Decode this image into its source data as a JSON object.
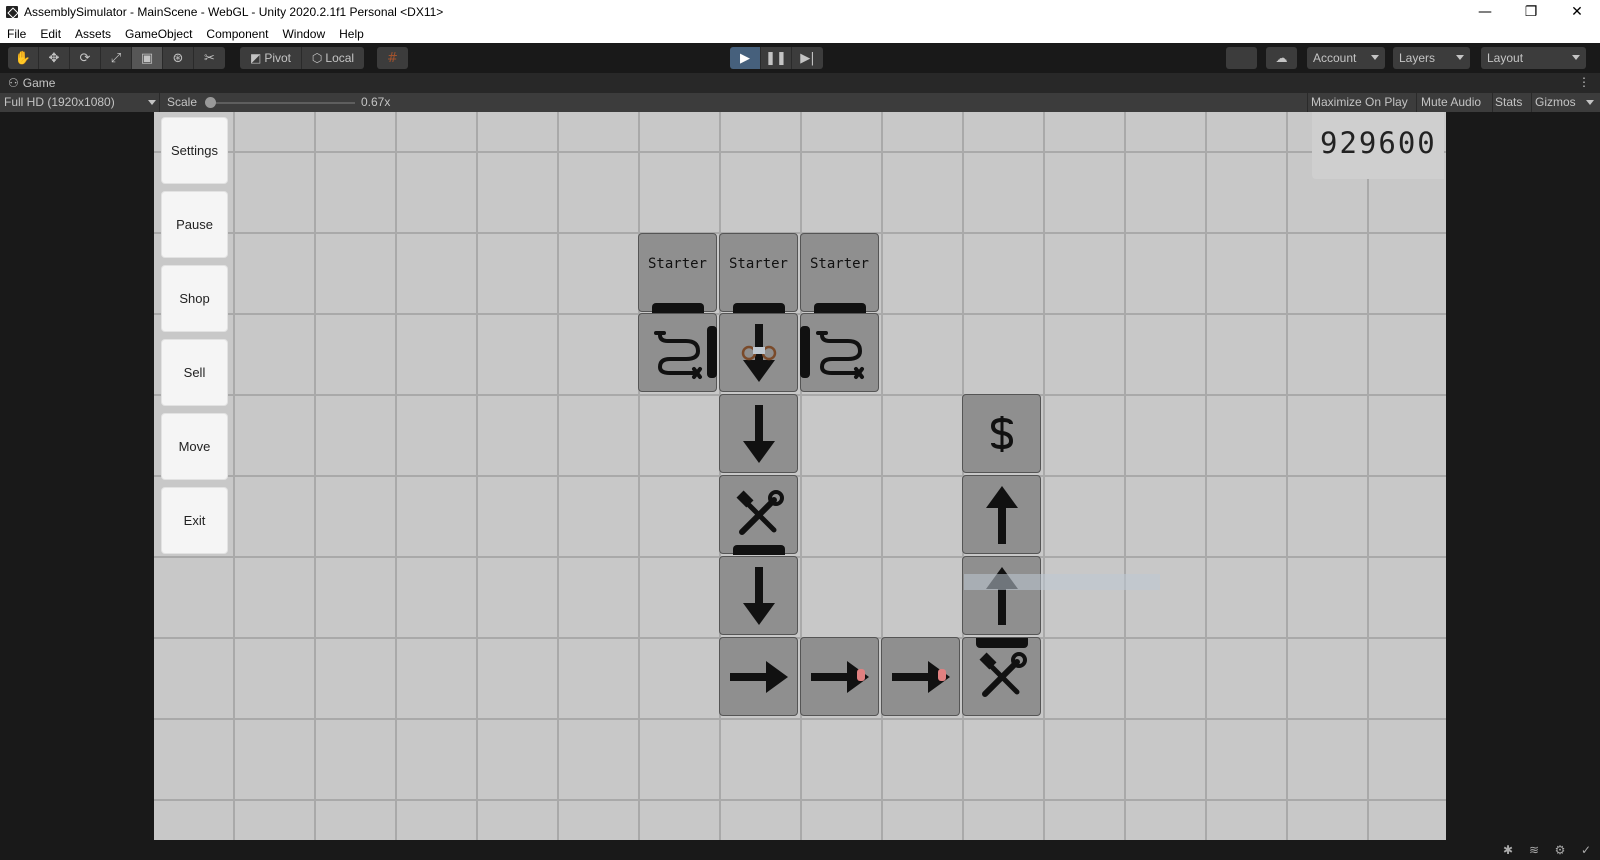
{
  "window": {
    "title": "AssemblySimulator - MainScene - WebGL - Unity 2020.2.1f1 Personal <DX11>",
    "minimize": "—",
    "restore": "❐",
    "close": "✕"
  },
  "menu": [
    "File",
    "Edit",
    "Assets",
    "GameObject",
    "Component",
    "Window",
    "Help"
  ],
  "toolbar": {
    "tools": [
      "hand-icon",
      "move-icon",
      "rotate-icon",
      "scale-icon",
      "rect-icon",
      "transform-icon",
      "custom-tool-icon"
    ],
    "pivot_label": "Pivot",
    "local_label": "Local",
    "account_label": "Account",
    "layers_label": "Layers",
    "layout_label": "Layout"
  },
  "tab": {
    "label": "Game"
  },
  "gamebar": {
    "resolution": "Full HD (1920x1080)",
    "scale_label": "Scale",
    "scale_value": "0.67x",
    "scale_level": 0.0,
    "maximize": "Maximize On Play",
    "mute": "Mute Audio",
    "stats": "Stats",
    "gizmos": "Gizmos"
  },
  "game": {
    "buttons": [
      "Settings",
      "Pause",
      "Shop",
      "Sell",
      "Move",
      "Exit"
    ],
    "score": "929600",
    "starter_label": "Starter"
  },
  "colors": {
    "editor_bg": "#191919",
    "game_bg": "#c8c8c8",
    "tile": "#8f8f8f",
    "play_active": "#46607c"
  }
}
